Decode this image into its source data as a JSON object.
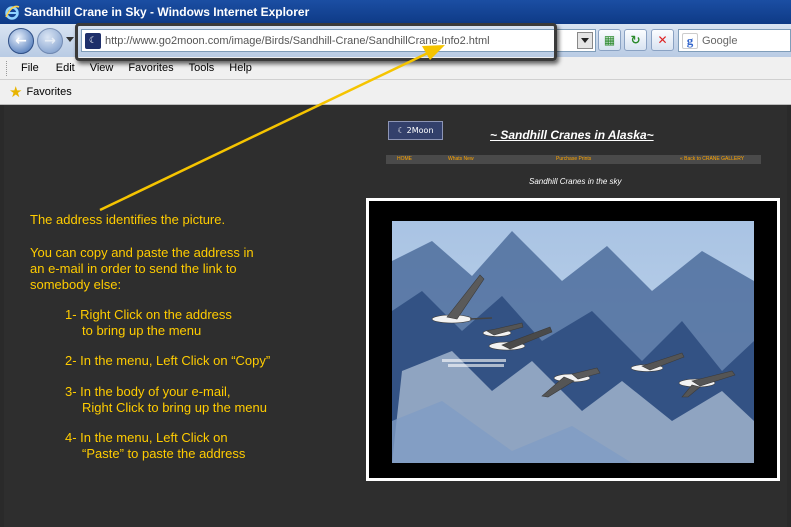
{
  "window": {
    "title": "Sandhill Crane in Sky - Windows Internet Explorer"
  },
  "navbar": {
    "address_url": "http://www.go2moon.com/image/Birds/Sandhill-Crane/SandhillCrane-Info2.html",
    "search_placeholder": "Google",
    "icons": [
      "back-icon",
      "forward-icon",
      "compat-view-icon",
      "refresh-icon",
      "stop-icon",
      "google-icon"
    ]
  },
  "menubar": {
    "items": [
      "File",
      "Edit",
      "View",
      "Favorites",
      "Tools",
      "Help"
    ]
  },
  "favorites_bar": {
    "label": "Favorites"
  },
  "page": {
    "logo_text": "2Moon",
    "heading": "~ Sandhill Cranes in Alaska~",
    "nav": {
      "home": "HOME",
      "whats_new": "Whats New",
      "purchase": "Purchase Prints",
      "back": "« Back to CRANE GALLERY"
    },
    "photo_caption": "Sandhill Cranes in the sky"
  },
  "annotation": {
    "line1": "The address identifies the picture.",
    "para2_line1": "You can copy and paste the address in",
    "para2_line2": "an e-mail in order to send the link to",
    "para2_line3": "somebody else:",
    "step1_line1": "1- Right Click on the address",
    "step1_line2": "to bring up the menu",
    "step2_line1": "2- In the menu, Left Click on “Copy”",
    "step3_line1": "3- In the body of your e-mail,",
    "step3_line2": "Right Click to bring up the menu",
    "step4_line1": "4- In the menu, Left Click on",
    "step4_line2": "“Paste” to paste the address",
    "text_color": "#ffcc00",
    "arrow_color": "#f5c400"
  }
}
